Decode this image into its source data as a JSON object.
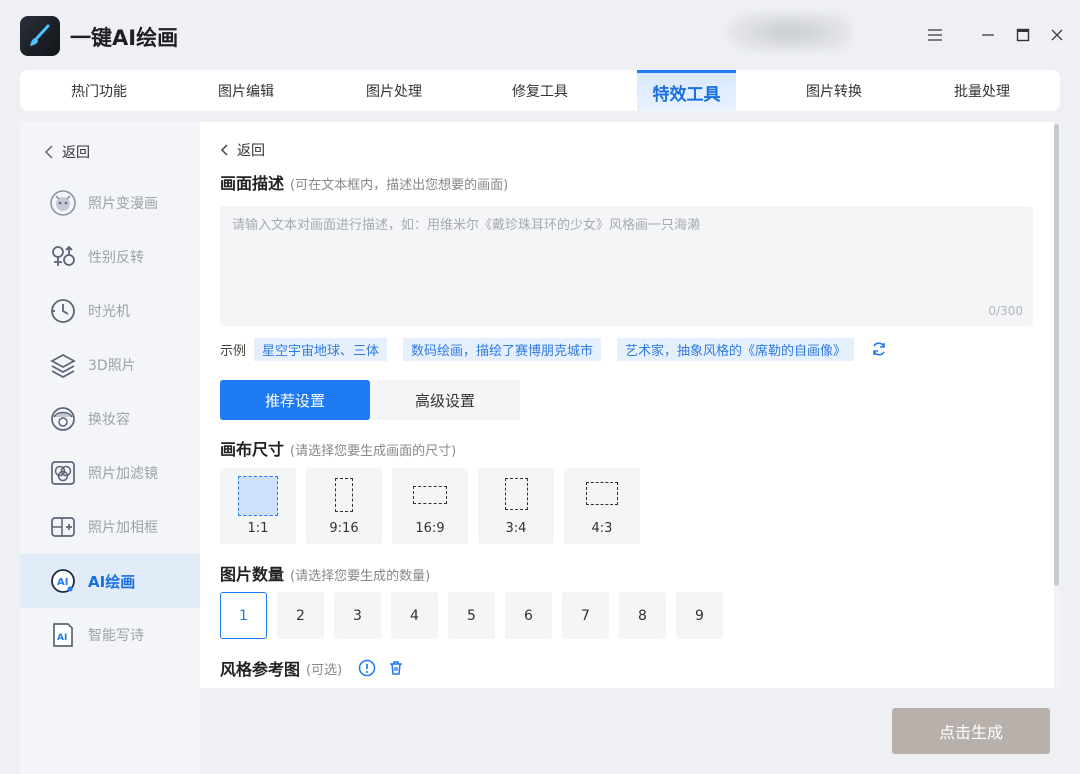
{
  "app": {
    "title": "一键AI绘画"
  },
  "tabs": [
    {
      "label": "热门功能"
    },
    {
      "label": "图片编辑"
    },
    {
      "label": "图片处理"
    },
    {
      "label": "修复工具"
    },
    {
      "label": "特效工具"
    },
    {
      "label": "图片转换"
    },
    {
      "label": "批量处理"
    }
  ],
  "sidebar": {
    "back": "返回",
    "items": [
      {
        "label": "照片变漫画",
        "icon": "cartoon-face-icon"
      },
      {
        "label": "性别反转",
        "icon": "gender-icon"
      },
      {
        "label": "时光机",
        "icon": "clock-icon"
      },
      {
        "label": "3D照片",
        "icon": "layers-icon"
      },
      {
        "label": "换妆容",
        "icon": "makeup-icon"
      },
      {
        "label": "照片加滤镜",
        "icon": "filter-icon"
      },
      {
        "label": "照片加相框",
        "icon": "frame-icon"
      },
      {
        "label": "AI绘画",
        "icon": "ai-paint-icon"
      },
      {
        "label": "智能写诗",
        "icon": "ai-poem-icon"
      }
    ]
  },
  "main": {
    "back": "返回",
    "desc_title": "画面描述",
    "desc_hint": "(可在文本框内，描述出您想要的画面)",
    "desc_placeholder": "请输入文本对画面进行描述，如：用维米尔《戴珍珠耳环的少女》风格画一只海濑",
    "desc_counter": "0/300",
    "examples_label": "示例",
    "examples": [
      "星空宇宙地球、三体",
      "数码绘画，描绘了赛博朋克城市",
      "艺术家，抽象风格的《席勒的自画像》"
    ],
    "setting_tabs": [
      "推荐设置",
      "高级设置"
    ],
    "canvas_title": "画布尺寸",
    "canvas_hint": "(请选择您要生成画面的尺寸)",
    "sizes": [
      "1:1",
      "9:16",
      "16:9",
      "3:4",
      "4:3"
    ],
    "count_title": "图片数量",
    "count_hint": "(请选择您要生成的数量)",
    "counts": [
      "1",
      "2",
      "3",
      "4",
      "5",
      "6",
      "7",
      "8",
      "9"
    ],
    "style_title": "风格参考图",
    "style_hint": "(可选)"
  },
  "generate_label": "点击生成",
  "colors": {
    "accent": "#1e7af2",
    "chip_bg": "#e6f0fc",
    "generate_bg": "#b8b0ab"
  }
}
